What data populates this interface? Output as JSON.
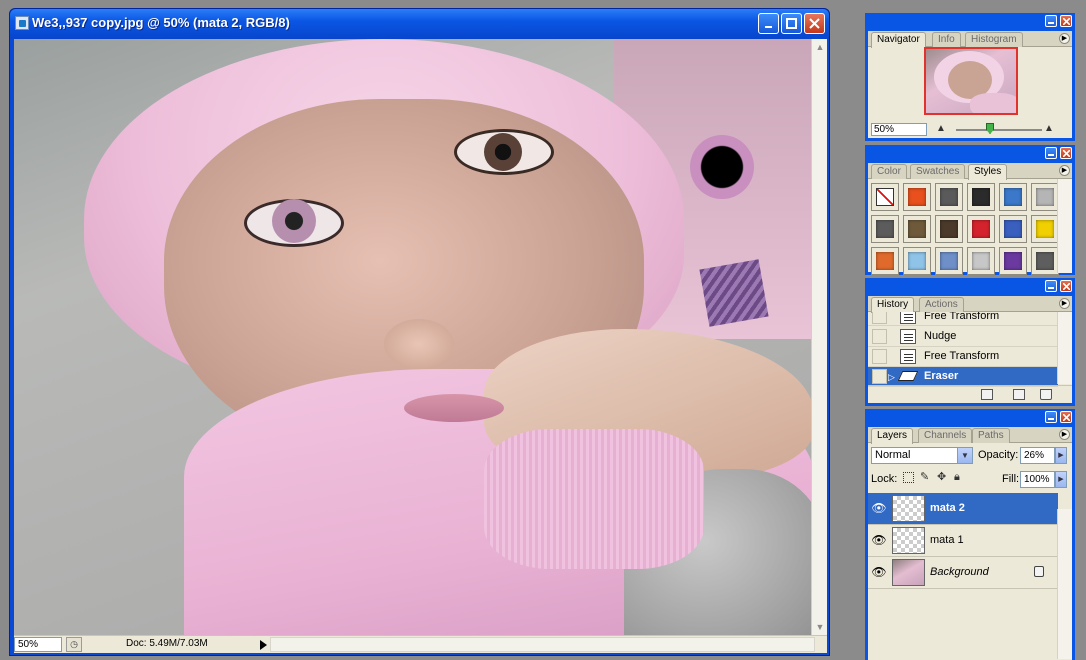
{
  "document": {
    "title": "We3,,937 copy.jpg @ 50% (mata 2, RGB/8)",
    "zoom": "50%",
    "doc_info": "Doc: 5.49M/7.03M"
  },
  "navigator": {
    "tabs": [
      "Navigator",
      "Info",
      "Histogram"
    ],
    "zoom": "50%"
  },
  "styles_panel": {
    "tabs": [
      "Color",
      "Swatches",
      "Styles"
    ],
    "swatches": [
      "none",
      "#e8501d",
      "#5a5a5a",
      "#2b2b2b",
      "#3b78c9",
      "#b5b5b5",
      "#5c5c5c",
      "#6e5a3b",
      "#4b3a2a",
      "#d4232c",
      "#3a5fbf",
      "#f0d000",
      "#e06a2c",
      "#8fc4e8",
      "#6e8fc8",
      "#c7c7c7",
      "#6a3aa0",
      "#5e5e5e"
    ]
  },
  "history": {
    "tabs": [
      "History",
      "Actions"
    ],
    "items": [
      {
        "label": "Free Transform",
        "selected": false
      },
      {
        "label": "Nudge",
        "selected": false
      },
      {
        "label": "Free Transform",
        "selected": false
      },
      {
        "label": "Eraser",
        "selected": true
      }
    ]
  },
  "layers": {
    "tabs": [
      "Layers",
      "Channels",
      "Paths"
    ],
    "blend_mode": "Normal",
    "opacity_label": "Opacity:",
    "opacity": "26%",
    "lock_label": "Lock:",
    "fill_label": "Fill:",
    "fill": "100%",
    "items": [
      {
        "name": "mata 2",
        "selected": true
      },
      {
        "name": "mata 1",
        "selected": false
      },
      {
        "name": "Background",
        "selected": false
      }
    ]
  },
  "colors": {
    "titlebar": "#0a56e4",
    "selection": "#316ac5",
    "panel_bg": "#ece9d8"
  }
}
